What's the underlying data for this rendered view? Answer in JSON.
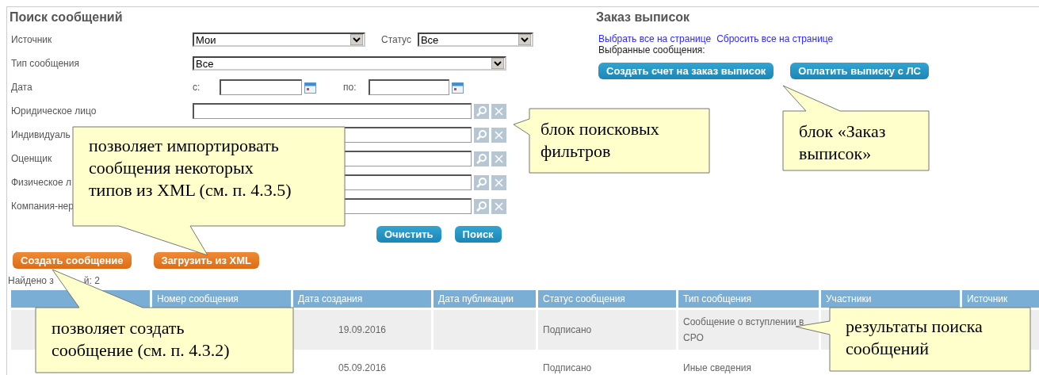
{
  "search": {
    "title": "Поиск сообщений",
    "rows": [
      {
        "kind": "select_pair",
        "label": "Источник",
        "value": "Мои",
        "second_label": "Статус",
        "second_value": "Все"
      },
      {
        "kind": "select_wide",
        "label": "Тип сообщения",
        "value": "Все"
      },
      {
        "kind": "date_range",
        "label": "Дата",
        "from_label": "с:",
        "to_label": "по:"
      },
      {
        "kind": "lookup",
        "label": "Юридическое лицо"
      },
      {
        "kind": "lookup",
        "label": "Индивидуаль"
      },
      {
        "kind": "lookup",
        "label": "Оценщик"
      },
      {
        "kind": "lookup",
        "label": "Физическое л"
      },
      {
        "kind": "lookup",
        "label": "Компания-нер"
      }
    ],
    "buttons": [
      "Очистить",
      "Поиск"
    ]
  },
  "actions": [
    "Создать сообщение",
    "Загрузить из XML"
  ],
  "found": [
    "Найдено з",
    "й: 2"
  ],
  "order": {
    "title": "Заказ выписок",
    "links": [
      "Выбрать все на странице",
      "Сбросить все на странице"
    ],
    "selected_label": "Выбранные сообщения:",
    "buttons": [
      "Создать счет на заказ выписок",
      "Оплатить выписку с ЛС"
    ]
  },
  "table": {
    "columns": [
      {},
      {
        "label": "Номер сообщения"
      },
      {
        "label": "Дата создания"
      },
      {
        "label": "Дата публикации"
      },
      {
        "label": "Статус сообщения"
      },
      {
        "label": "Тип сообщения"
      },
      {
        "label": "Участники"
      },
      {
        "label": "Источник"
      }
    ],
    "rows": [
      {
        "cells": [
          null,
          null,
          "19.09.2016",
          null,
          "Подписано",
          "Сообщение о вступлении в СРО",
          null,
          null
        ]
      },
      {
        "cells": [
          null,
          null,
          "05.09.2016",
          null,
          "Подписано",
          "Иные сведения",
          null,
          null
        ]
      }
    ]
  },
  "callouts": [
    {
      "text": "позволяет импортировать\nсообщения некоторых\nтипов из XML (см. п. 4.3.5)"
    },
    {
      "text": "блок поисковых\nфильтров"
    },
    {
      "text": "блок «Заказ\nвыписок»"
    },
    {
      "text": "позволяет создать\nсообщение (см. п. 4.3.2)"
    },
    {
      "text": "результаты поиска\nсообщений"
    }
  ]
}
